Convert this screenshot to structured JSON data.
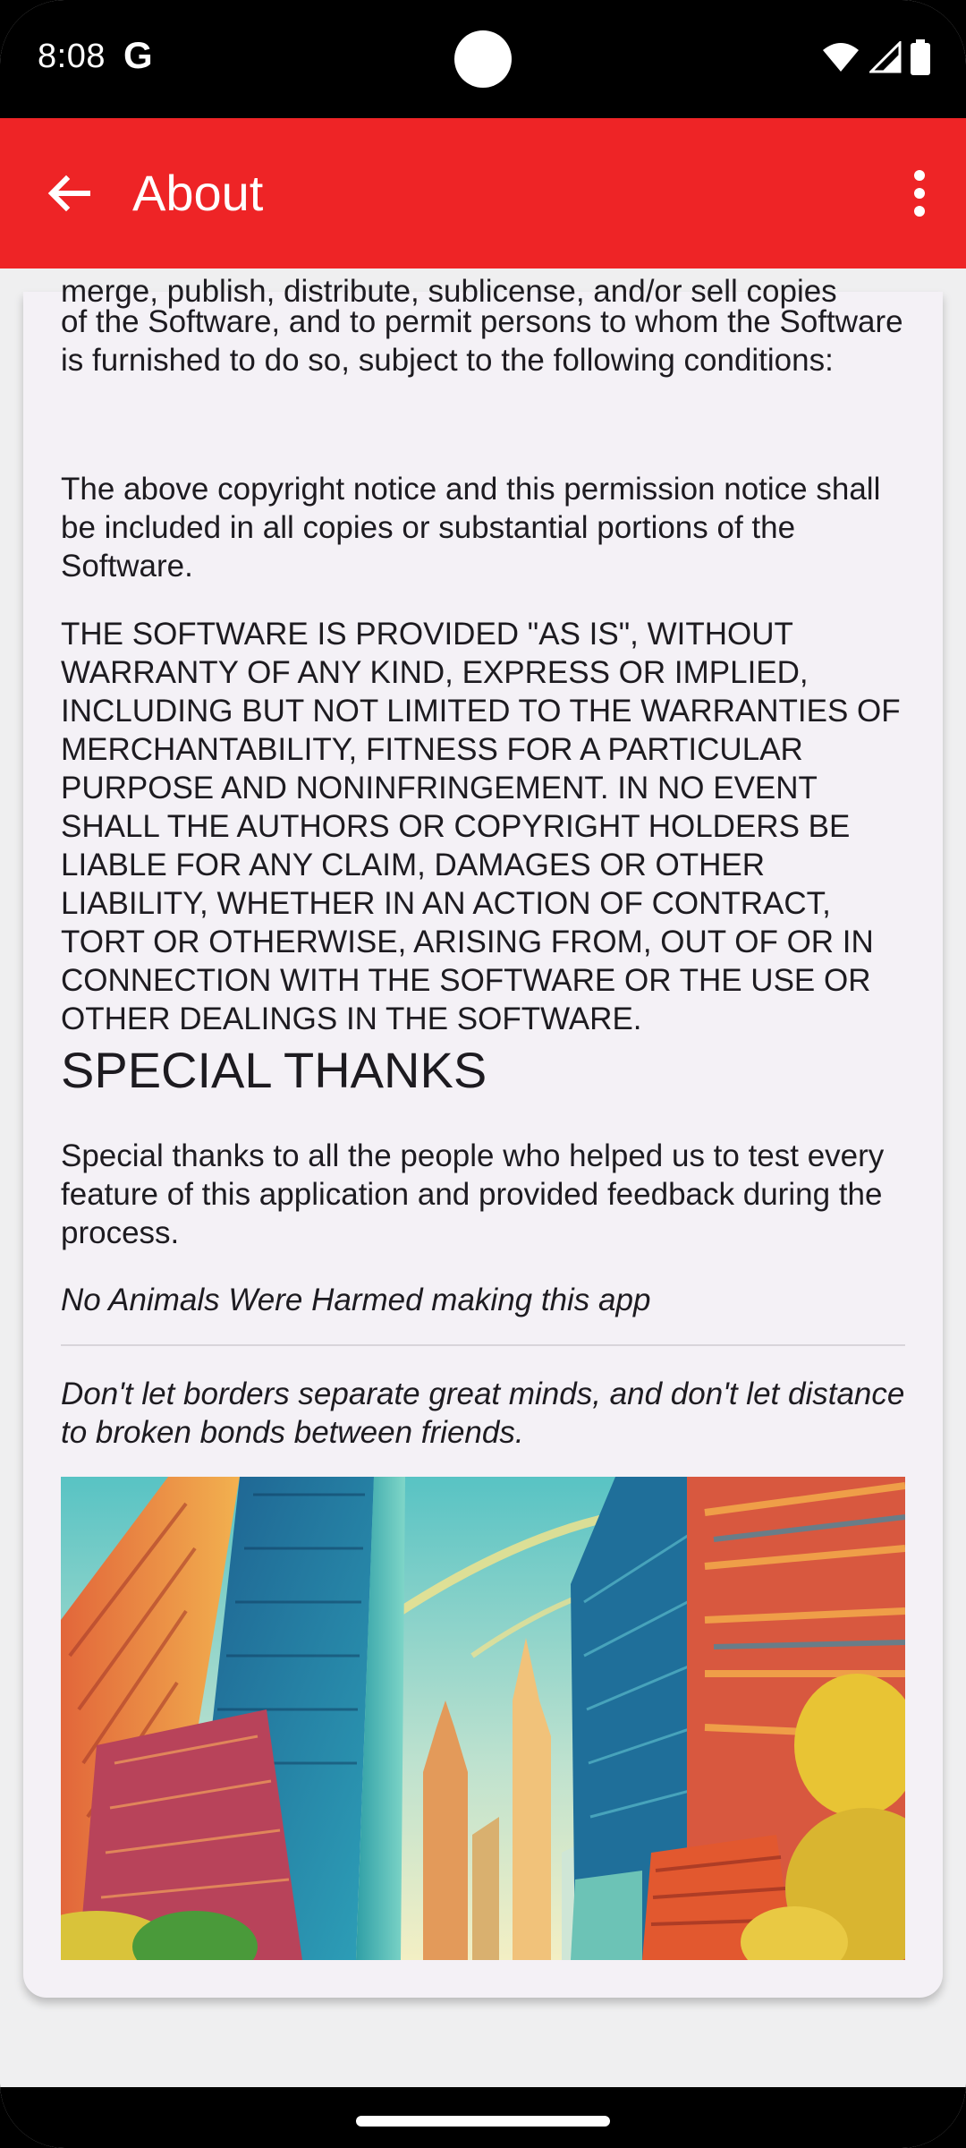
{
  "status_bar": {
    "time": "8:08",
    "g_label": "G"
  },
  "app_bar": {
    "title": "About"
  },
  "content": {
    "cut_line": "merge, publish, distribute, sublicense, and/or sell copies",
    "paragraph_1": "of the Software, and to permit persons to whom the Software is furnished to do so, subject to the following conditions:",
    "paragraph_2": "The above copyright notice and this permission notice shall be included in all copies or substantial portions of the Software.",
    "paragraph_3": "THE SOFTWARE IS PROVIDED \"AS IS\", WITHOUT WARRANTY OF ANY KIND, EXPRESS OR IMPLIED, INCLUDING BUT NOT LIMITED TO THE WARRANTIES OF MERCHANTABILITY, FITNESS FOR A PARTICULAR PURPOSE AND NONINFRINGEMENT. IN NO EVENT SHALL THE AUTHORS OR COPYRIGHT HOLDERS BE LIABLE FOR ANY CLAIM, DAMAGES OR OTHER LIABILITY, WHETHER IN AN ACTION OF CONTRACT, TORT OR OTHERWISE, ARISING FROM, OUT OF OR IN CONNECTION WITH THE SOFTWARE OR THE USE OR OTHER DEALINGS IN THE SOFTWARE.",
    "special_thanks_heading": "SPECIAL THANKS",
    "special_thanks_text": "Special thanks to all the people who helped us to test every feature of this application and provided feedback during the process.",
    "animals_note": "No Animals Were Harmed making this app",
    "quote": "Don't let borders separate great minds, and don't let distance to broken bonds between friends."
  },
  "icons": {
    "back": "arrow-left-icon",
    "menu": "more-vert-icon",
    "wifi": "wifi-icon",
    "signal": "cell-signal-icon",
    "battery": "battery-icon"
  },
  "colors": {
    "app_bar": "#ee2426",
    "card": "#f4f1f6",
    "background": "#efeff0"
  }
}
